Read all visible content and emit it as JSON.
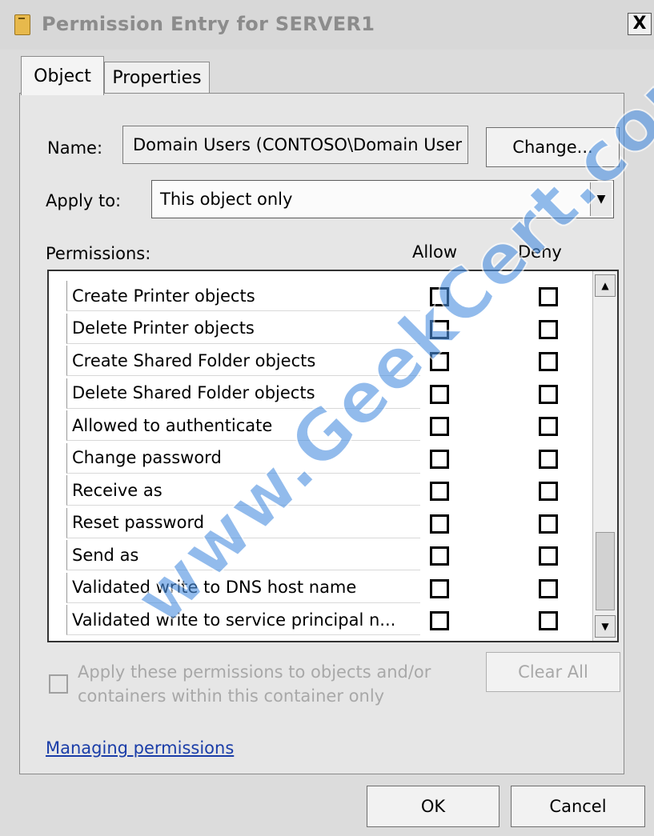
{
  "window": {
    "title": "Permission Entry for SERVER1",
    "close_label": "X"
  },
  "tabs": [
    {
      "label": "Object",
      "selected": true
    },
    {
      "label": "Properties",
      "selected": false
    }
  ],
  "name": {
    "label": "Name:",
    "value": "Domain Users (CONTOSO\\Domain User",
    "change_button": "Change..."
  },
  "apply_to": {
    "label": "Apply to:",
    "value": "This object only"
  },
  "permissions": {
    "label": "Permissions:",
    "allow_header": "Allow",
    "deny_header": "Deny",
    "rows": [
      {
        "name": "Create Printer objects",
        "allow": false,
        "deny": false
      },
      {
        "name": "Delete Printer objects",
        "allow": false,
        "deny": false
      },
      {
        "name": "Create Shared Folder objects",
        "allow": false,
        "deny": false
      },
      {
        "name": "Delete Shared Folder objects",
        "allow": false,
        "deny": false
      },
      {
        "name": "Allowed to authenticate",
        "allow": false,
        "deny": false
      },
      {
        "name": "Change password",
        "allow": false,
        "deny": false
      },
      {
        "name": "Receive as",
        "allow": false,
        "deny": false
      },
      {
        "name": "Reset password",
        "allow": false,
        "deny": false
      },
      {
        "name": "Send as",
        "allow": false,
        "deny": false
      },
      {
        "name": "Validated write to DNS host name",
        "allow": false,
        "deny": false
      },
      {
        "name": "Validated write to service principal n...",
        "allow": false,
        "deny": false
      }
    ]
  },
  "inherit": {
    "checked": false,
    "text": "Apply these permissions to objects and/or containers within this container only"
  },
  "clear_all": "Clear All",
  "link": "Managing permissions",
  "buttons": {
    "ok": "OK",
    "cancel": "Cancel"
  },
  "watermark": "www.GeekCert.com",
  "icons": {
    "title": "folder-lock-icon",
    "close": "close-icon",
    "dropdown": "chevron-down-icon",
    "scroll_up": "scroll-up-icon",
    "scroll_down": "scroll-down-icon"
  }
}
